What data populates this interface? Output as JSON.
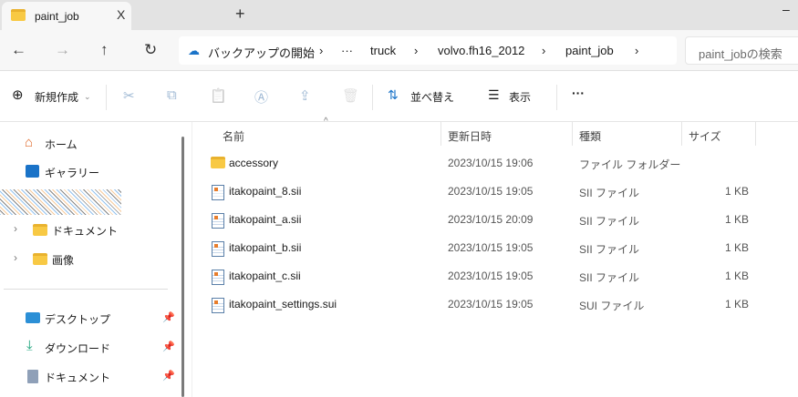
{
  "window": {
    "tab_title": "paint_job",
    "close_tab": "X",
    "new_tab": "+",
    "minimize": "–"
  },
  "nav": {
    "back": "←",
    "forward": "→",
    "up": "↑",
    "refresh": "↻"
  },
  "breadcrumb": {
    "backup": "バックアップの開始",
    "sep": "›",
    "more": "···",
    "items": [
      "truck",
      "volvo.fh16_2012",
      "paint_job"
    ]
  },
  "search": {
    "placeholder": "paint_jobの検索"
  },
  "toolbar": {
    "new": "新規作成",
    "sort": "並べ替え",
    "view": "表示",
    "more": "···",
    "cut": "✂",
    "copy": "⧉",
    "paste": "📋",
    "rename": "Ⓐ",
    "share": "⇪",
    "delete": "🗑"
  },
  "sidebar": {
    "items": [
      {
        "label": "ホーム",
        "icon": "home-icon"
      },
      {
        "label": "ギャラリー",
        "icon": "gallery-icon"
      },
      {
        "label": "ドキュメント",
        "icon": "folder-icon"
      },
      {
        "label": "画像",
        "icon": "folder-icon"
      },
      {
        "label": "デスクトップ",
        "icon": "desktop-icon"
      },
      {
        "label": "ダウンロード",
        "icon": "download-icon"
      },
      {
        "label": "ドキュメント",
        "icon": "document-icon"
      }
    ]
  },
  "columns": {
    "name": "名前",
    "date": "更新日時",
    "type": "種類",
    "size": "サイズ"
  },
  "files": [
    {
      "name": "accessory",
      "date": "2023/10/15 19:06",
      "type": "ファイル フォルダー",
      "size": ""
    },
    {
      "name": "itakopaint_8.sii",
      "date": "2023/10/15 19:05",
      "type": "SII ファイル",
      "size": "1 KB"
    },
    {
      "name": "itakopaint_a.sii",
      "date": "2023/10/15 20:09",
      "type": "SII ファイル",
      "size": "1 KB"
    },
    {
      "name": "itakopaint_b.sii",
      "date": "2023/10/15 19:05",
      "type": "SII ファイル",
      "size": "1 KB"
    },
    {
      "name": "itakopaint_c.sii",
      "date": "2023/10/15 19:05",
      "type": "SII ファイル",
      "size": "1 KB"
    },
    {
      "name": "itakopaint_settings.sui",
      "date": "2023/10/15 19:05",
      "type": "SUI ファイル",
      "size": "1 KB"
    }
  ]
}
